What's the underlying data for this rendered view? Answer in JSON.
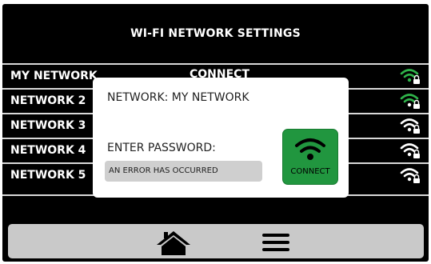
{
  "header": {
    "title": "WI-FI NETWORK SETTINGS"
  },
  "networks": [
    {
      "name": "MY NETWORK",
      "action": "CONNECT",
      "signal_color": "#2fb44a"
    },
    {
      "name": "NETWORK 2",
      "action": "",
      "signal_color": "#ffffff"
    },
    {
      "name": "NETWORK 3",
      "action": "",
      "signal_color": "#ffffff"
    },
    {
      "name": "NETWORK 4",
      "action": "",
      "signal_color": "#ffffff"
    },
    {
      "name": "NETWORK 5",
      "action": "",
      "signal_color": "#ffffff"
    }
  ],
  "dialog": {
    "network_label": "NETWORK: MY NETWORK",
    "password_label": "ENTER PASSWORD:",
    "password_field_text": "AN ERROR HAS OCCURRED",
    "connect_label": "CONNECT",
    "connect_icon": "wifi-icon"
  },
  "bottom_bar": {
    "home_icon": "home-icon",
    "menu_icon": "hamburger-menu-icon"
  },
  "colors": {
    "accent_green": "#21963f",
    "background": "#000000",
    "bar": "#c9c9c9"
  }
}
